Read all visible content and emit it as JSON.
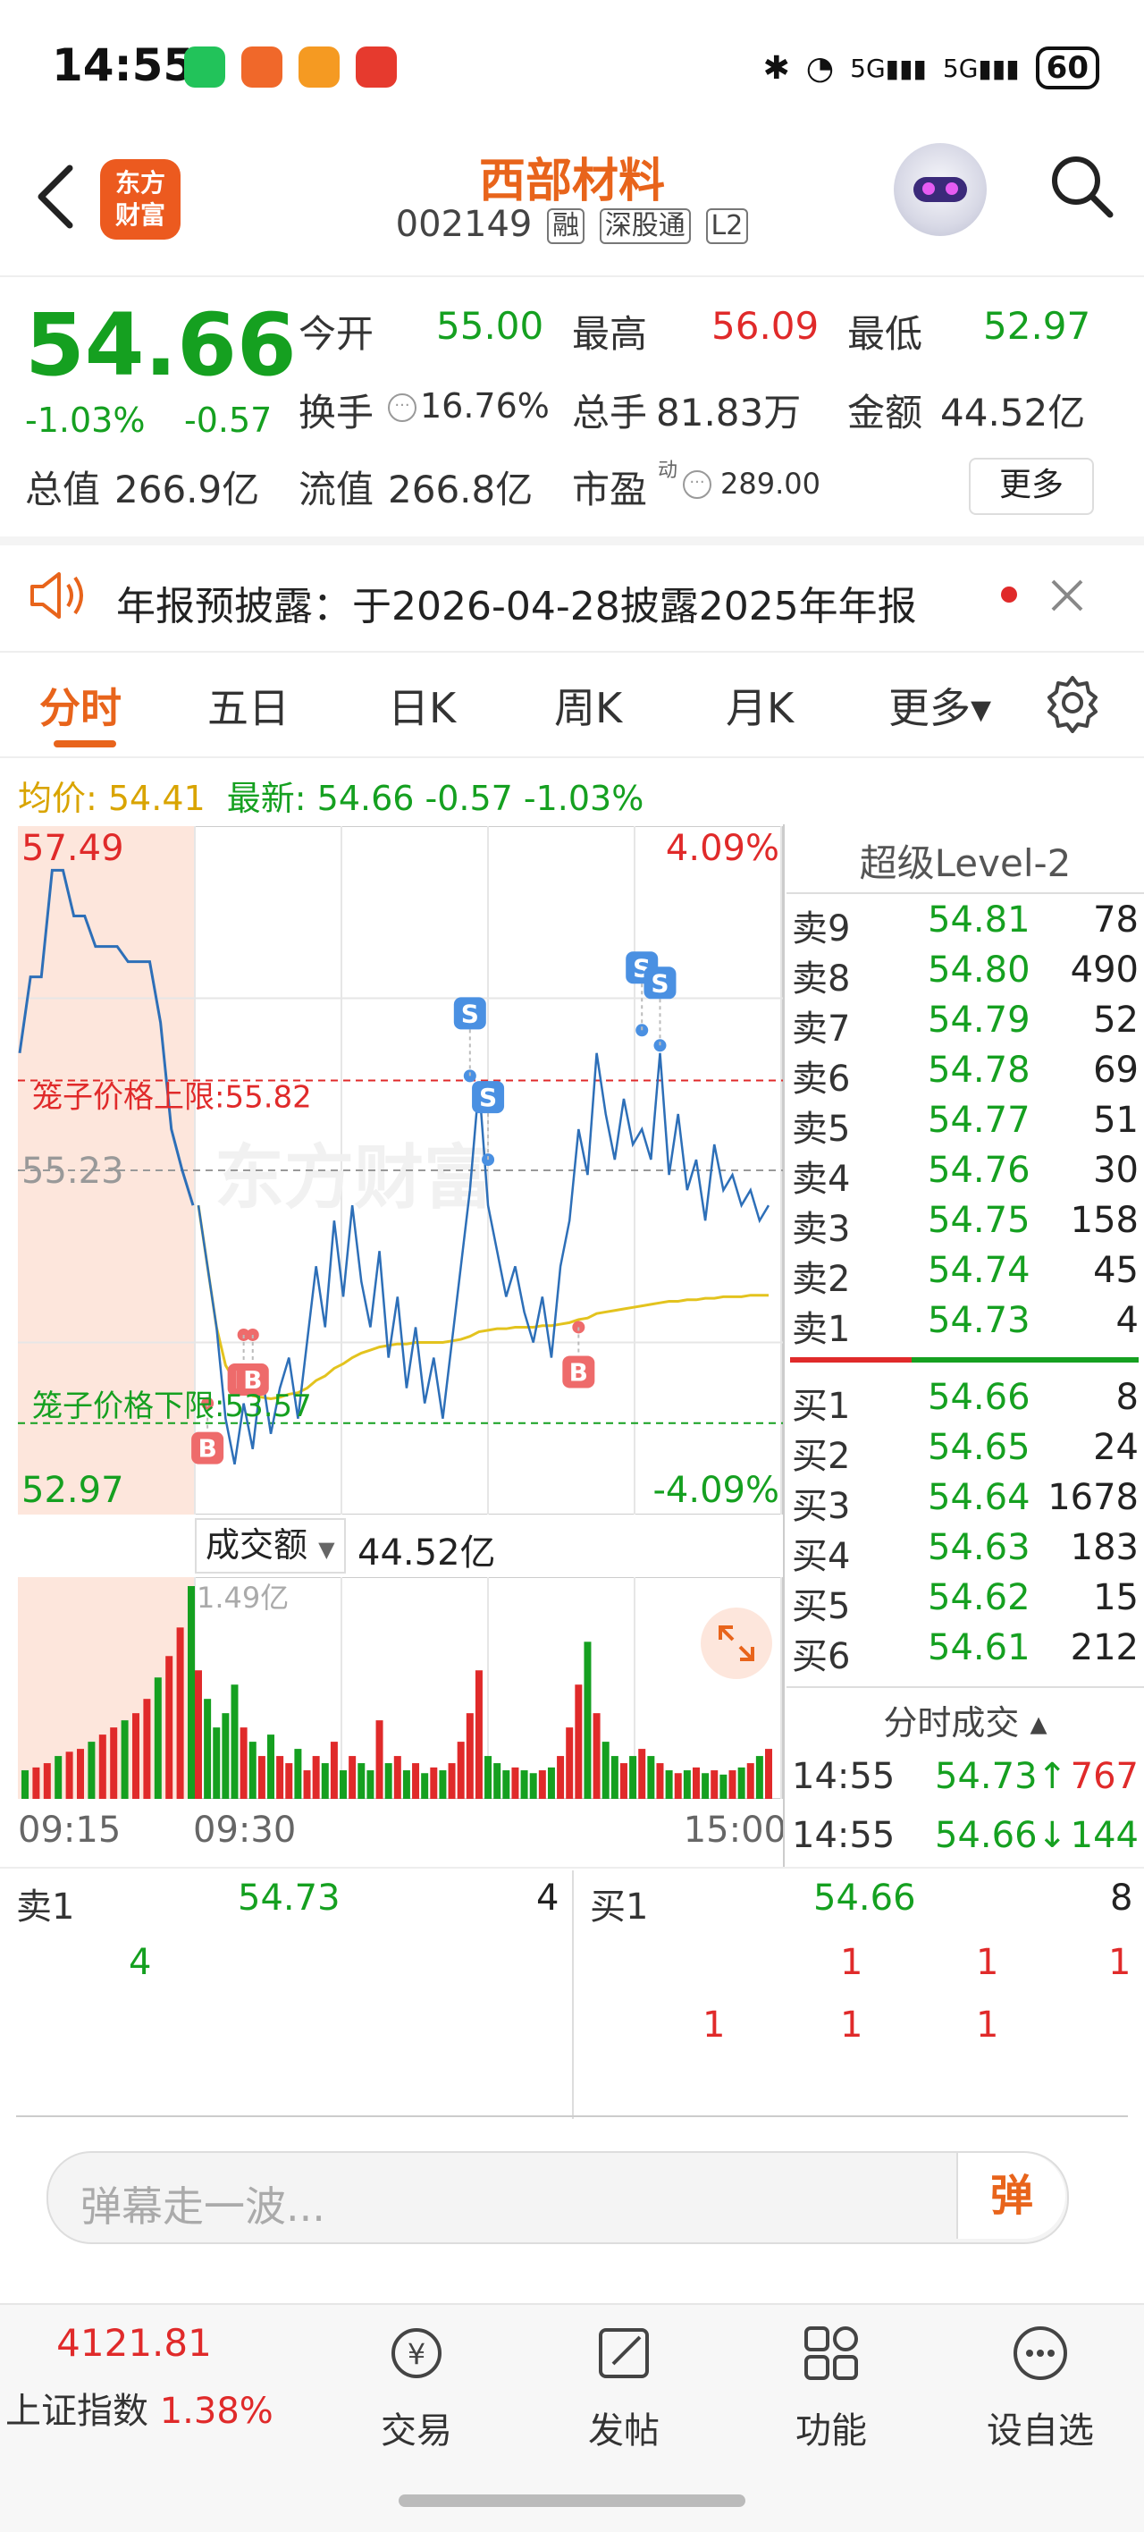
{
  "status_bar": {
    "time": "14:55",
    "battery": "60"
  },
  "header": {
    "logo_text_1": "东方",
    "logo_text_2": "财富",
    "stock_name": "西部材料",
    "stock_code": "002149",
    "tags": [
      "融",
      "深股通",
      "L2"
    ]
  },
  "quote": {
    "price": "54.66",
    "change_pct": "-1.03%",
    "change_abs": "-0.57",
    "open_label": "今开",
    "open": "55.00",
    "high_label": "最高",
    "high": "56.09",
    "low_label": "最低",
    "low": "52.97",
    "turnover_label": "换手",
    "turnover": "16.76%",
    "volume_label": "总手",
    "volume": "81.83万",
    "amount_label": "金额",
    "amount": "44.52亿",
    "mktcap_label": "总值",
    "mktcap": "266.9亿",
    "float_label": "流值",
    "float": "266.8亿",
    "pe_label": "市盈",
    "pe_sup": "动",
    "pe": "289.00",
    "more_label": "更多"
  },
  "notice": {
    "text": "年报预披露：于2026-04-28披露2025年年报"
  },
  "tabs": [
    "分时",
    "五日",
    "日K",
    "周K",
    "月K",
    "更多▾"
  ],
  "avg_row": {
    "avg": "均价: 54.41",
    "latest": "最新: 54.66 -0.57 -1.03%"
  },
  "chart_data": {
    "type": "line",
    "price_high_label": "57.49",
    "price_low_label": "52.97",
    "pct_high_label": "4.09%",
    "pct_low_label": "-4.09%",
    "prev_close_label": "55.23",
    "cage_upper_label": "笼子价格上限:55.82",
    "cage_lower_label": "笼子价格下限:53.57",
    "watermark": "东方财富",
    "ylim": [
      52.97,
      57.49
    ],
    "prev_close": 55.23,
    "cage_upper": 55.82,
    "cage_lower": 53.57,
    "pre_auction_price": [
      56.0,
      56.5,
      56.5,
      57.2,
      57.2,
      56.9,
      56.9,
      56.7,
      56.7,
      56.7,
      56.6,
      56.6,
      56.6,
      56.2,
      55.5,
      55.23,
      55.0
    ],
    "price": [
      55.0,
      54.6,
      54.2,
      53.6,
      53.3,
      53.7,
      53.4,
      53.9,
      53.5,
      53.8,
      54.0,
      53.6,
      54.1,
      54.6,
      54.2,
      54.9,
      54.4,
      55.0,
      54.5,
      54.2,
      54.7,
      54.0,
      54.4,
      53.8,
      54.2,
      53.7,
      54.0,
      53.6,
      54.1,
      54.6,
      55.1,
      55.8,
      55.0,
      54.7,
      54.4,
      54.6,
      54.3,
      54.1,
      54.4,
      54.0,
      54.6,
      54.9,
      55.5,
      55.2,
      56.0,
      55.6,
      55.3,
      55.7,
      55.4,
      55.5,
      55.3,
      56.0,
      55.2,
      55.6,
      55.1,
      55.3,
      54.9,
      55.4,
      55.1,
      55.2,
      55.0,
      55.1,
      54.9,
      55.0
    ],
    "avg_price": [
      55.0,
      54.6,
      54.2,
      53.95,
      53.85,
      53.78,
      53.75,
      53.74,
      53.73,
      53.74,
      53.76,
      53.77,
      53.8,
      53.85,
      53.88,
      53.93,
      53.96,
      54.0,
      54.03,
      54.05,
      54.07,
      54.08,
      54.09,
      54.09,
      54.1,
      54.1,
      54.1,
      54.1,
      54.11,
      54.12,
      54.14,
      54.17,
      54.18,
      54.19,
      54.19,
      54.2,
      54.2,
      54.2,
      54.21,
      54.21,
      54.22,
      54.23,
      54.25,
      54.26,
      54.29,
      54.3,
      54.31,
      54.32,
      54.33,
      54.34,
      54.35,
      54.36,
      54.37,
      54.37,
      54.38,
      54.38,
      54.39,
      54.39,
      54.4,
      54.4,
      54.4,
      54.41,
      54.41,
      54.41
    ],
    "markers": [
      {
        "label": "B",
        "i": 1,
        "price": 53.7
      },
      {
        "label": "B",
        "i": 5,
        "price": 54.15
      },
      {
        "label": "B",
        "i": 6,
        "price": 54.15
      },
      {
        "label": "B",
        "i": 42,
        "price": 54.2
      },
      {
        "label": "S",
        "i": 30,
        "price": 55.85
      },
      {
        "label": "S",
        "i": 32,
        "price": 55.3
      },
      {
        "label": "S",
        "i": 49,
        "price": 56.15
      },
      {
        "label": "S",
        "i": 51,
        "price": 56.05
      }
    ],
    "volume_label": "成交额",
    "volume_total": "44.52亿",
    "volume_max_label": "1.49亿",
    "pre_volume": [
      0.2,
      0.22,
      0.25,
      0.3,
      0.33,
      0.35,
      0.4,
      0.45,
      0.5,
      0.55,
      0.6,
      0.7,
      0.85,
      1.0,
      1.2,
      1.49
    ],
    "volume": [
      0.9,
      0.7,
      0.5,
      0.6,
      0.8,
      0.5,
      0.4,
      0.3,
      0.45,
      0.3,
      0.25,
      0.35,
      0.2,
      0.3,
      0.25,
      0.4,
      0.2,
      0.3,
      0.25,
      0.2,
      0.55,
      0.25,
      0.3,
      0.2,
      0.25,
      0.18,
      0.22,
      0.2,
      0.25,
      0.4,
      0.6,
      0.9,
      0.3,
      0.25,
      0.2,
      0.22,
      0.2,
      0.18,
      0.2,
      0.22,
      0.3,
      0.5,
      0.8,
      1.1,
      0.6,
      0.4,
      0.3,
      0.25,
      0.3,
      0.35,
      0.3,
      0.25,
      0.2,
      0.18,
      0.2,
      0.22,
      0.18,
      0.2,
      0.17,
      0.2,
      0.22,
      0.25,
      0.3,
      0.35
    ],
    "times": [
      "09:15",
      "09:30",
      "15:00"
    ]
  },
  "level2": {
    "title": "超级Level-2",
    "asks": [
      {
        "label": "卖9",
        "price": "54.81",
        "vol": "78"
      },
      {
        "label": "卖8",
        "price": "54.80",
        "vol": "490"
      },
      {
        "label": "卖7",
        "price": "54.79",
        "vol": "52"
      },
      {
        "label": "卖6",
        "price": "54.78",
        "vol": "69"
      },
      {
        "label": "卖5",
        "price": "54.77",
        "vol": "51"
      },
      {
        "label": "卖4",
        "price": "54.76",
        "vol": "30"
      },
      {
        "label": "卖3",
        "price": "54.75",
        "vol": "158"
      },
      {
        "label": "卖2",
        "price": "54.74",
        "vol": "45"
      },
      {
        "label": "卖1",
        "price": "54.73",
        "vol": "4"
      }
    ],
    "bids": [
      {
        "label": "买1",
        "price": "54.66",
        "vol": "8"
      },
      {
        "label": "买2",
        "price": "54.65",
        "vol": "24"
      },
      {
        "label": "买3",
        "price": "54.64",
        "vol": "1678"
      },
      {
        "label": "买4",
        "price": "54.63",
        "vol": "183"
      },
      {
        "label": "买5",
        "price": "54.62",
        "vol": "15"
      },
      {
        "label": "买6",
        "price": "54.61",
        "vol": "212"
      }
    ],
    "ticks_title": "分时成交 ▴",
    "ticks": [
      {
        "time": "14:55",
        "price": "54.73↑",
        "vol": "767",
        "dir": "up"
      },
      {
        "time": "14:55",
        "price": "54.66↓",
        "vol": "144",
        "dir": "down"
      }
    ]
  },
  "queues": {
    "sell_label": "卖1",
    "sell_price": "54.73",
    "sell_vol": "4",
    "sell_orders": [
      "4"
    ],
    "buy_label": "买1",
    "buy_price": "54.66",
    "buy_vol": "8",
    "buy_orders_row1": [
      "1",
      "1",
      "1"
    ],
    "buy_orders_row2": [
      "1",
      "1",
      "1"
    ]
  },
  "danmaku": {
    "placeholder": "弹幕走一波...",
    "button": "弹"
  },
  "bottom_nav": {
    "index_value": "4121.81",
    "index_name": "上证指数",
    "index_change": "1.38%",
    "items": [
      "交易",
      "发帖",
      "功能",
      "设自选"
    ]
  }
}
